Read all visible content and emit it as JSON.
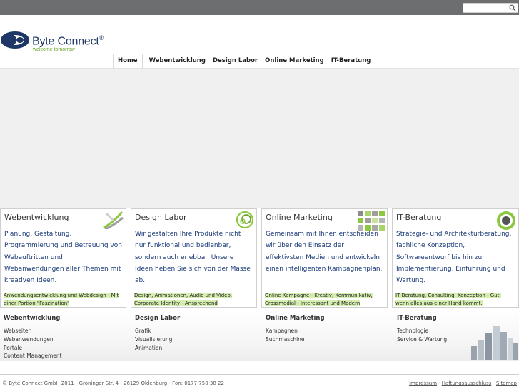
{
  "search": {
    "placeholder": ""
  },
  "brand": {
    "name": "Byte Connect",
    "tagline": "welcome tomorrow",
    "colors": {
      "navy": "#1e3764",
      "green": "#6aa32a"
    }
  },
  "nav": {
    "items": [
      {
        "label": "Home",
        "active": true
      },
      {
        "label": "Webentwicklung",
        "active": false
      },
      {
        "label": "Design Labor",
        "active": false
      },
      {
        "label": "Online Marketing",
        "active": false
      },
      {
        "label": "IT-Beratung",
        "active": false
      }
    ]
  },
  "boxes": [
    {
      "title": "Webentwicklung",
      "icon": "swoosh-icon",
      "desc": "Planung, Gestaltung, Programmierung und Betreuung von Webauftritten und Webanwendungen aller Themen mit kreativen Ideen.",
      "foot": "Anwendungsentwicklung und Webdesign - Mit einer Portion \"Faszination\""
    },
    {
      "title": "Design Labor",
      "icon": "circle-swirl-icon",
      "desc": "Wir gestalten Ihre Produkte nicht nur funktional und bedienbar, sondern auch erlebbar. Unsere Ideen heben Sie sich von der Masse ab.",
      "foot": "Design, Animationen, Audio und Video, Corporate Identity - Ansprechend"
    },
    {
      "title": "Online Marketing",
      "icon": "grid-squares-icon",
      "desc": "Gemeinsam mit Ihnen entscheiden wir über den Einsatz der effektivsten Medien und entwickeln einen intelligenten Kampagnenplan.",
      "foot": "Online Kampagne - Kreativ, Kommunikativ, Crossmedial - Interessant und Modern"
    },
    {
      "title": "IT-Beratung",
      "icon": "target-ring-icon",
      "desc": "Strategie- und Architekturberatung, fachliche Konzeption, Softwareentwurf bis hin zur Implementierung, Einführung und Wartung.",
      "foot": "IT Beratung, Consulting, Konzeption - Gut, wenn alles aus einer Hand kommt."
    }
  ],
  "sitemap": [
    {
      "head": "Webentwicklung",
      "links": [
        "Webseiten",
        "Webanwendungen",
        "Portale",
        "Content Management"
      ]
    },
    {
      "head": "Design Labor",
      "links": [
        "Grafik",
        "Visualisierung",
        "Animation"
      ]
    },
    {
      "head": "Online Marketing",
      "links": [
        "Kampagnen",
        "Suchmaschine"
      ]
    },
    {
      "head": "IT-Beratung",
      "links": [
        "Technologie",
        "Service & Wartung"
      ]
    }
  ],
  "footer": {
    "copyright": "© Byte Connect GmbH 2011 - Groninger Str. 4 - 26129 Oldenburg - Fon: 0177 750 38 22",
    "links": [
      "Impressum",
      "Haftungsausschluss",
      "Sitemap"
    ]
  }
}
